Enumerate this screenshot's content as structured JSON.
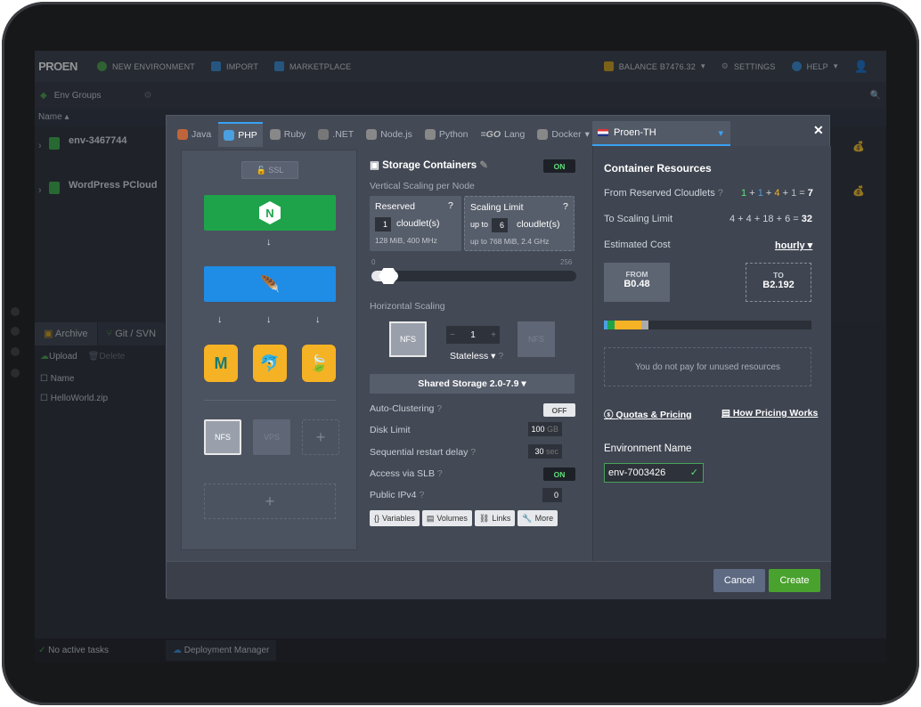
{
  "topbar": {
    "logo": "PROEN",
    "new_env": "NEW ENVIRONMENT",
    "import": "IMPORT",
    "marketplace": "MARKETPLACE",
    "balance": "BALANCE B7476.32",
    "settings": "SETTINGS",
    "help": "HELP"
  },
  "envbar": {
    "env_groups": "Env Groups"
  },
  "list_header": {
    "name": "Name"
  },
  "environments": [
    {
      "name": "env-3467744"
    },
    {
      "name": "WordPress PCloud"
    }
  ],
  "bottom_tabs": {
    "archive": "Archive",
    "git": "Git / SVN"
  },
  "archive": {
    "upload": "Upload",
    "delete": "Delete",
    "name_col": "Name",
    "file": "HelloWorld.zip"
  },
  "status": {
    "tasks": "No active tasks",
    "deploy": "Deployment Manager"
  },
  "dialog": {
    "tech_tabs": [
      "Java",
      "PHP",
      "Ruby",
      ".NET",
      "Node.js",
      "Python",
      "Lang",
      "Docker"
    ],
    "active_tab": "PHP",
    "region": "Proen-TH",
    "ssl": "SSL",
    "storage_nodes": {
      "nfs": "NFS",
      "vps": "VPS"
    },
    "config": {
      "title": "Storage Containers",
      "title_toggle": "ON",
      "vertical_label": "Vertical Scaling per Node",
      "reserved_title": "Reserved",
      "reserved_value": "1",
      "reserved_unit": "cloudlet(s)",
      "reserved_spec": "128 MiB, 400 MHz",
      "scaling_title": "Scaling Limit",
      "scaling_prefix": "up to",
      "scaling_value": "6",
      "scaling_unit": "cloudlet(s)",
      "scaling_spec": "up to 768 MiB, 2.4 GHz",
      "slider_min": "0",
      "slider_max": "256",
      "horizontal_label": "Horizontal Scaling",
      "node_count": "1",
      "node_type": "NFS",
      "stateless": "Stateless",
      "shared_storage": "Shared Storage 2.0-7.9",
      "auto_clustering": "Auto-Clustering",
      "auto_clustering_toggle": "OFF",
      "disk_limit": "Disk Limit",
      "disk_value": "100",
      "disk_unit": "GB",
      "restart_delay": "Sequential restart delay",
      "restart_value": "30",
      "restart_unit": "sec",
      "slb": "Access via SLB",
      "slb_toggle": "ON",
      "ipv4": "Public IPv4",
      "ipv4_value": "0",
      "buttons": [
        "Variables",
        "Volumes",
        "Links",
        "More"
      ]
    },
    "resources": {
      "title": "Container Resources",
      "reserved_label": "From Reserved Cloudlets",
      "reserved_calc_parts": [
        "1",
        "+",
        "1",
        "+",
        "4",
        "+",
        "1",
        "="
      ],
      "reserved_total": "7",
      "scaling_label": "To Scaling Limit",
      "scaling_calc": "4 + 4 + 18 + 6 =",
      "scaling_total": "32",
      "estimated_cost": "Estimated Cost",
      "period": "hourly",
      "from_label": "FROM",
      "from_value": "B0.48",
      "to_label": "TO",
      "to_value": "B2.192",
      "unused_note": "You do not pay for unused resources",
      "quotas_link": "Quotas & Pricing",
      "pricing_link": "How Pricing Works",
      "env_name_label": "Environment Name",
      "env_name_value": "env-7003426"
    },
    "cancel": "Cancel",
    "create": "Create"
  },
  "colors": {
    "accent_green": "#1ea34a",
    "accent_blue": "#1f8ce6",
    "create_green": "#4aa22e",
    "cancel": "#5d6a82"
  }
}
